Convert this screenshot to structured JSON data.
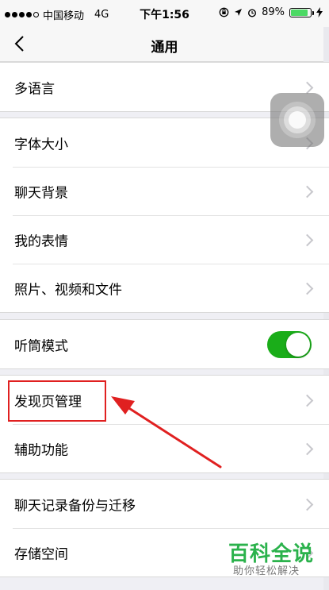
{
  "status_bar": {
    "carrier": "中国移动",
    "network": "4G",
    "time": "下午1:56",
    "battery_percent": "89%",
    "battery_level": 0.89
  },
  "nav": {
    "title": "通用",
    "back_icon": "chevron-left-icon"
  },
  "groups": [
    {
      "items": [
        {
          "label": "多语言",
          "accessory": "chevron"
        }
      ]
    },
    {
      "items": [
        {
          "label": "字体大小",
          "accessory": "chevron"
        },
        {
          "label": "聊天背景",
          "accessory": "chevron"
        },
        {
          "label": "我的表情",
          "accessory": "chevron"
        },
        {
          "label": "照片、视频和文件",
          "accessory": "chevron"
        }
      ]
    },
    {
      "items": [
        {
          "label": "听筒模式",
          "accessory": "toggle",
          "on": true
        }
      ]
    },
    {
      "items": [
        {
          "label": "发现页管理",
          "accessory": "chevron"
        },
        {
          "label": "辅助功能",
          "accessory": "chevron"
        }
      ]
    },
    {
      "items": [
        {
          "label": "聊天记录备份与迁移",
          "accessory": "chevron"
        },
        {
          "label": "存储空间",
          "accessory": "chevron"
        }
      ]
    }
  ],
  "watermark": {
    "title": "百科全说",
    "subtitle": "助你轻松解决"
  },
  "colors": {
    "toggle_on": "#1aad19",
    "highlight": "#e02020",
    "watermark": "#2bb24c"
  }
}
